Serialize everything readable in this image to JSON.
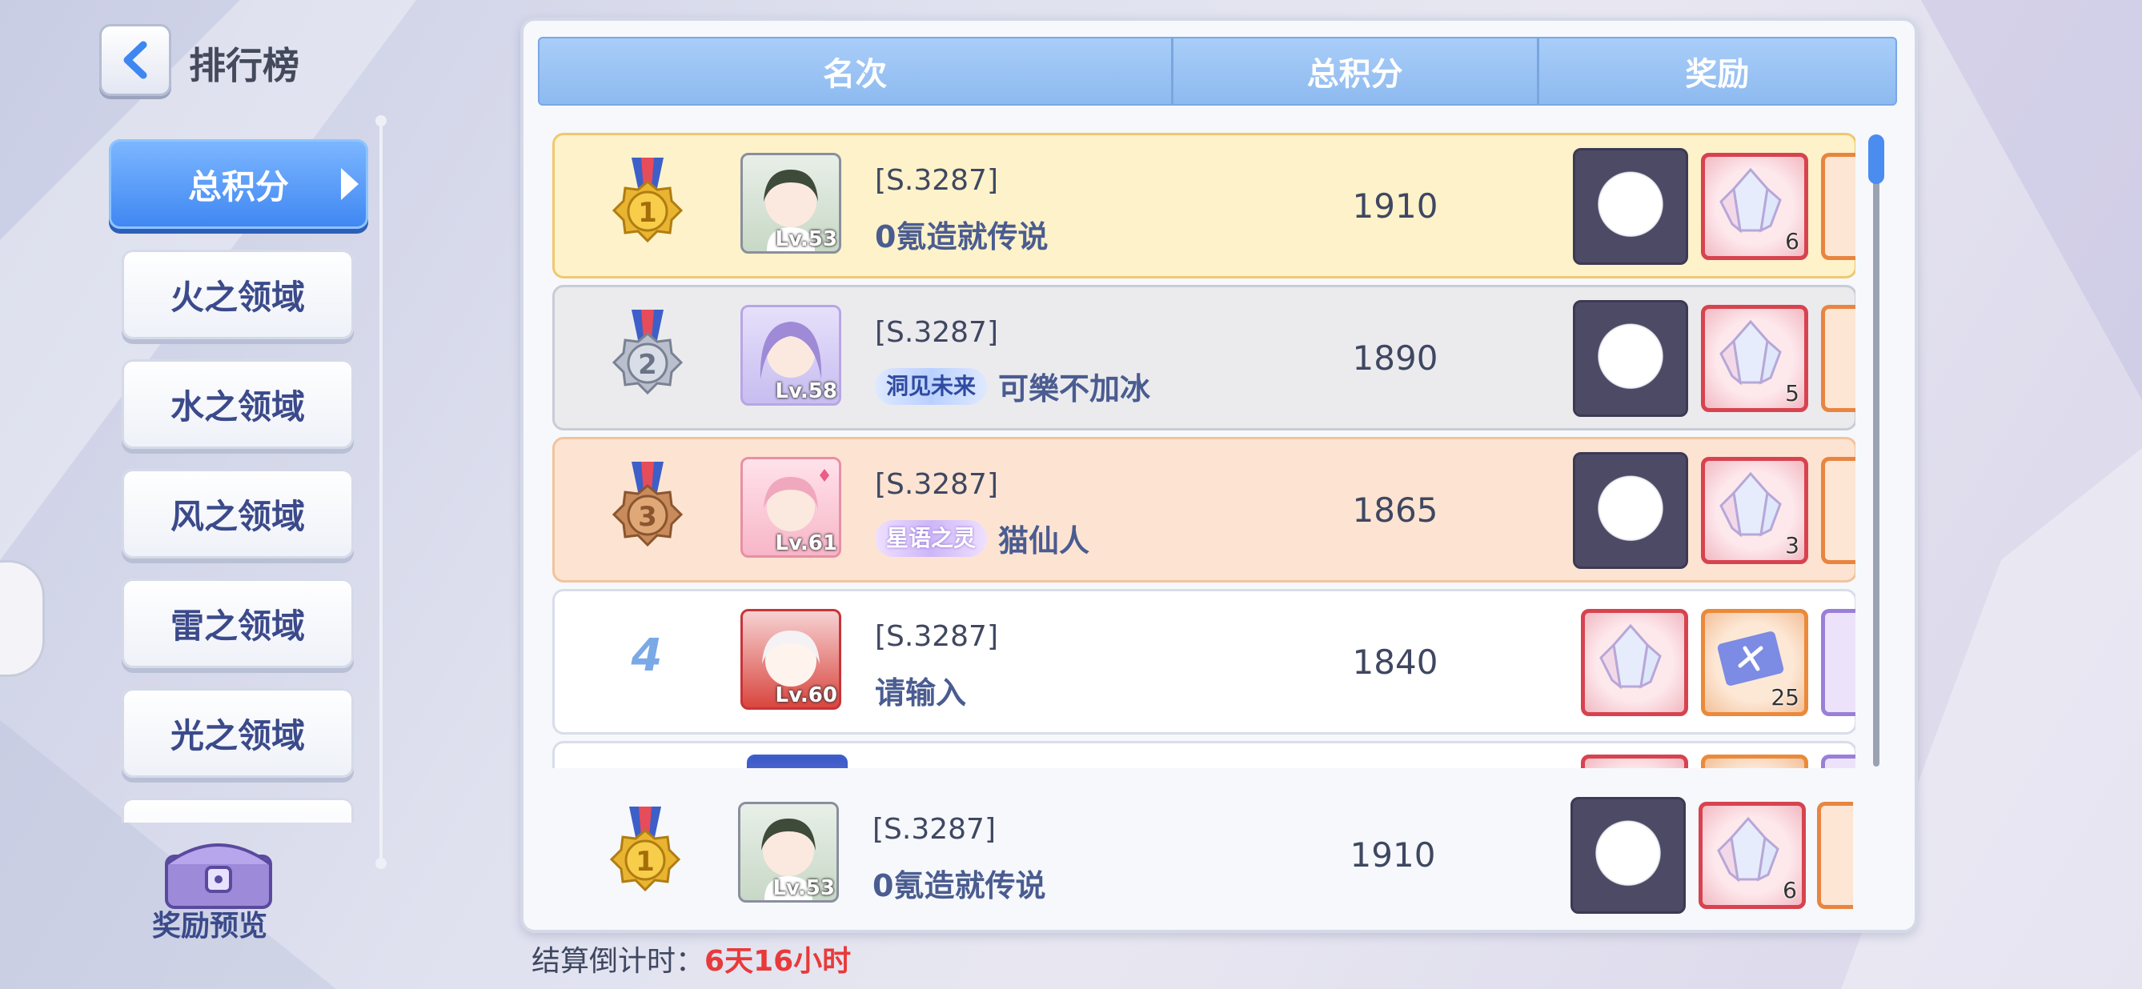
{
  "header": {
    "title": "排行榜"
  },
  "sidebar": {
    "items": [
      {
        "label": "总积分",
        "active": true
      },
      {
        "label": "火之领域",
        "active": false
      },
      {
        "label": "水之领域",
        "active": false
      },
      {
        "label": "风之领域",
        "active": false
      },
      {
        "label": "雷之领域",
        "active": false
      },
      {
        "label": "光之领域",
        "active": false
      },
      {
        "label": "",
        "active": false
      }
    ],
    "reward_preview": "奖励预览"
  },
  "table": {
    "headers": [
      "名次",
      "总积分",
      "奖励"
    ],
    "rows": [
      {
        "rank": "1",
        "server": "[S.3287]",
        "name": "0氪造就传说",
        "tag": "",
        "level": "Lv.53",
        "score": "1910",
        "rewards": [
          "frame",
          "crystal-6",
          "edge-orange"
        ],
        "crystal_count": "6"
      },
      {
        "rank": "2",
        "server": "[S.3287]",
        "name": "可樂不加冰",
        "tag": "洞见未来",
        "level": "Lv.58",
        "score": "1890",
        "rewards": [
          "frame",
          "crystal-5",
          "edge-orange"
        ],
        "crystal_count": "5"
      },
      {
        "rank": "3",
        "server": "[S.3287]",
        "name": "猫仙人",
        "tag": "星语之灵",
        "level": "Lv.61",
        "score": "1865",
        "rewards": [
          "frame",
          "crystal-3",
          "edge-orange"
        ],
        "crystal_count": "3"
      },
      {
        "rank": "4",
        "server": "[S.3287]",
        "name": "请输入",
        "tag": "",
        "level": "Lv.60",
        "score": "1840",
        "rewards": [
          "crystal",
          "ticket-25",
          "edge-purple"
        ],
        "ticket_count": "25"
      }
    ]
  },
  "my_rank": {
    "rank": "1",
    "server": "[S.3287]",
    "name": "0氪造就传说",
    "level": "Lv.53",
    "score": "1910",
    "crystal_count": "6"
  },
  "footer": {
    "countdown_label": "结算倒计时：",
    "countdown_value": "6天16小时"
  },
  "colors": {
    "accent": "#3e86f2",
    "gold": "#f0c870",
    "countdown": "#e83a3a"
  }
}
